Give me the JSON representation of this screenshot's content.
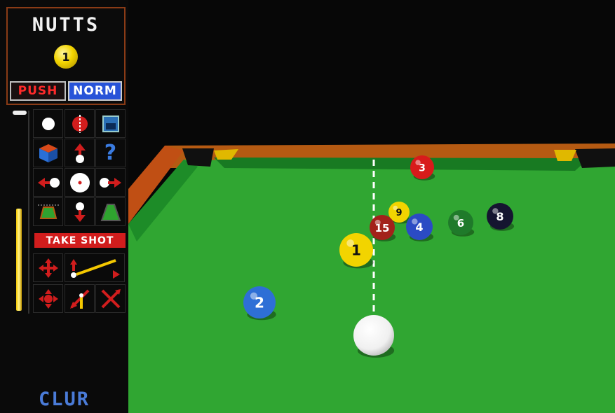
{
  "player": {
    "name": "NUTTS",
    "target_ball": "1"
  },
  "mode": {
    "push_label": "PUSH",
    "norm_label": "NORM",
    "active": "NORM"
  },
  "controls": {
    "take_shot_label": "TAKE SHOT",
    "footer_label": "CLUR",
    "power_level": 0.5,
    "help_symbol": "?"
  },
  "icons": [
    "cue-ball-icon",
    "spin-icon",
    "save-disk-icon",
    "view-cube-icon",
    "move-up-icon",
    "help-icon",
    "aim-left-icon",
    "center-hit-icon",
    "aim-right-icon",
    "table-view-icon",
    "move-down-icon",
    "perspective-icon",
    "rotate-move-icon",
    "elevation-icon",
    "cue-angle-icon",
    "zoom-move-icon",
    "pocket-aim-icon",
    "cue-swap-icon"
  ],
  "balls": [
    {
      "number": "3",
      "color": "#d81b1b"
    },
    {
      "number": "9",
      "color": "#f2d400"
    },
    {
      "number": "15",
      "color": "#a3221a"
    },
    {
      "number": "4",
      "color": "#2b4bc4"
    },
    {
      "number": "6",
      "color": "#1f7a2a"
    },
    {
      "number": "8",
      "color": "#151530"
    },
    {
      "number": "1",
      "color": "#f2d400"
    },
    {
      "number": "2",
      "color": "#2e6fd6"
    },
    {
      "number": "",
      "color": "#ffffff"
    }
  ],
  "colors": {
    "felt": "#2fa32f",
    "rail": "#b55a12",
    "cushion": "#1f8a2a",
    "panel_border": "#8a3b16",
    "accent_red": "#d11d1d"
  }
}
